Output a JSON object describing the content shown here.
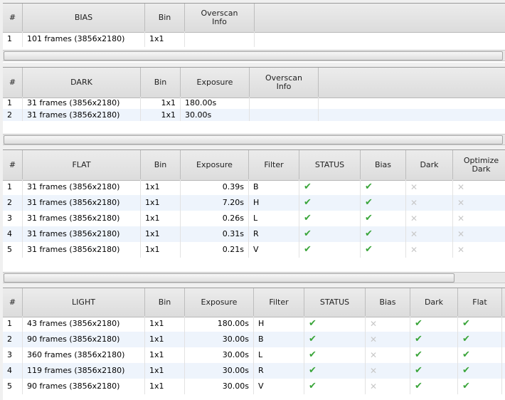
{
  "bias": {
    "headers": [
      "#",
      "BIAS",
      "Bin",
      "Overscan Info"
    ],
    "rows": [
      [
        "1",
        "101 frames (3856x2180)",
        "1x1",
        ""
      ]
    ]
  },
  "dark": {
    "headers": [
      "#",
      "DARK",
      "Bin",
      "Exposure",
      "Overscan Info"
    ],
    "rows": [
      [
        "1",
        "31 frames (3856x2180)",
        "1x1",
        "180.00s",
        ""
      ],
      [
        "2",
        "31 frames (3856x2180)",
        "1x1",
        "30.00s",
        ""
      ]
    ]
  },
  "flat": {
    "headers": [
      "#",
      "FLAT",
      "Bin",
      "Exposure",
      "Filter",
      "STATUS",
      "Bias",
      "Dark",
      "Optimize Dark"
    ],
    "rows": [
      [
        "1",
        "31 frames (3856x2180)",
        "1x1",
        "0.39s",
        "B",
        "check",
        "check",
        "x",
        "x"
      ],
      [
        "2",
        "31 frames (3856x2180)",
        "1x1",
        "7.20s",
        "H",
        "check",
        "check",
        "x",
        "x"
      ],
      [
        "3",
        "31 frames (3856x2180)",
        "1x1",
        "0.26s",
        "L",
        "check",
        "check",
        "x",
        "x"
      ],
      [
        "4",
        "31 frames (3856x2180)",
        "1x1",
        "0.31s",
        "R",
        "check",
        "check",
        "x",
        "x"
      ],
      [
        "5",
        "31 frames (3856x2180)",
        "1x1",
        "0.21s",
        "V",
        "check",
        "check",
        "x",
        "x"
      ]
    ]
  },
  "light": {
    "headers": [
      "#",
      "LIGHT",
      "Bin",
      "Exposure",
      "Filter",
      "STATUS",
      "Bias",
      "Dark",
      "Flat"
    ],
    "rows": [
      [
        "1",
        "43 frames (3856x2180)",
        "1x1",
        "180.00s",
        "H",
        "check",
        "x",
        "check",
        "check"
      ],
      [
        "2",
        "90 frames (3856x2180)",
        "1x1",
        "30.00s",
        "B",
        "check",
        "x",
        "check",
        "check"
      ],
      [
        "3",
        "360 frames (3856x2180)",
        "1x1",
        "30.00s",
        "L",
        "check",
        "x",
        "check",
        "check"
      ],
      [
        "4",
        "119 frames (3856x2180)",
        "1x1",
        "30.00s",
        "R",
        "check",
        "x",
        "check",
        "check"
      ],
      [
        "5",
        "90 frames (3856x2180)",
        "1x1",
        "30.00s",
        "V",
        "check",
        "x",
        "check",
        "check"
      ]
    ]
  },
  "icons": {
    "check": "check-icon",
    "x": "x-icon",
    "colors": {
      "check": "#3aa53a",
      "x": "#c8c8c8",
      "alt_row": "#eef4fc"
    }
  }
}
